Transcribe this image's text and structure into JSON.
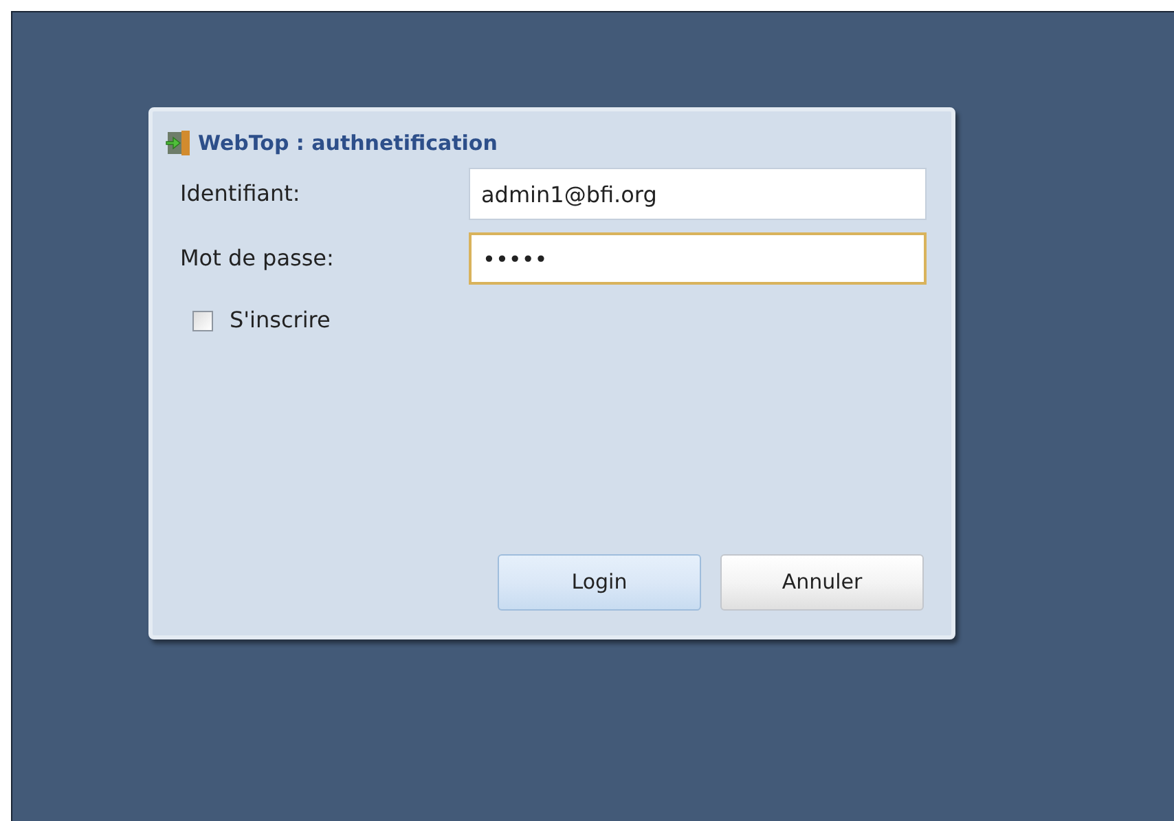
{
  "dialog": {
    "title": "WebTop : authnetification"
  },
  "fields": [
    {
      "label": "Identifiant:",
      "value": "admin1@bfi.org",
      "focused": false
    },
    {
      "label": "Mot de passe:",
      "value": "•••••",
      "focused": true
    }
  ],
  "checkbox": {
    "label": "S'inscrire",
    "checked": false
  },
  "buttons": [
    {
      "label": "Login",
      "default": true
    },
    {
      "label": "Annuler",
      "default": false
    }
  ]
}
